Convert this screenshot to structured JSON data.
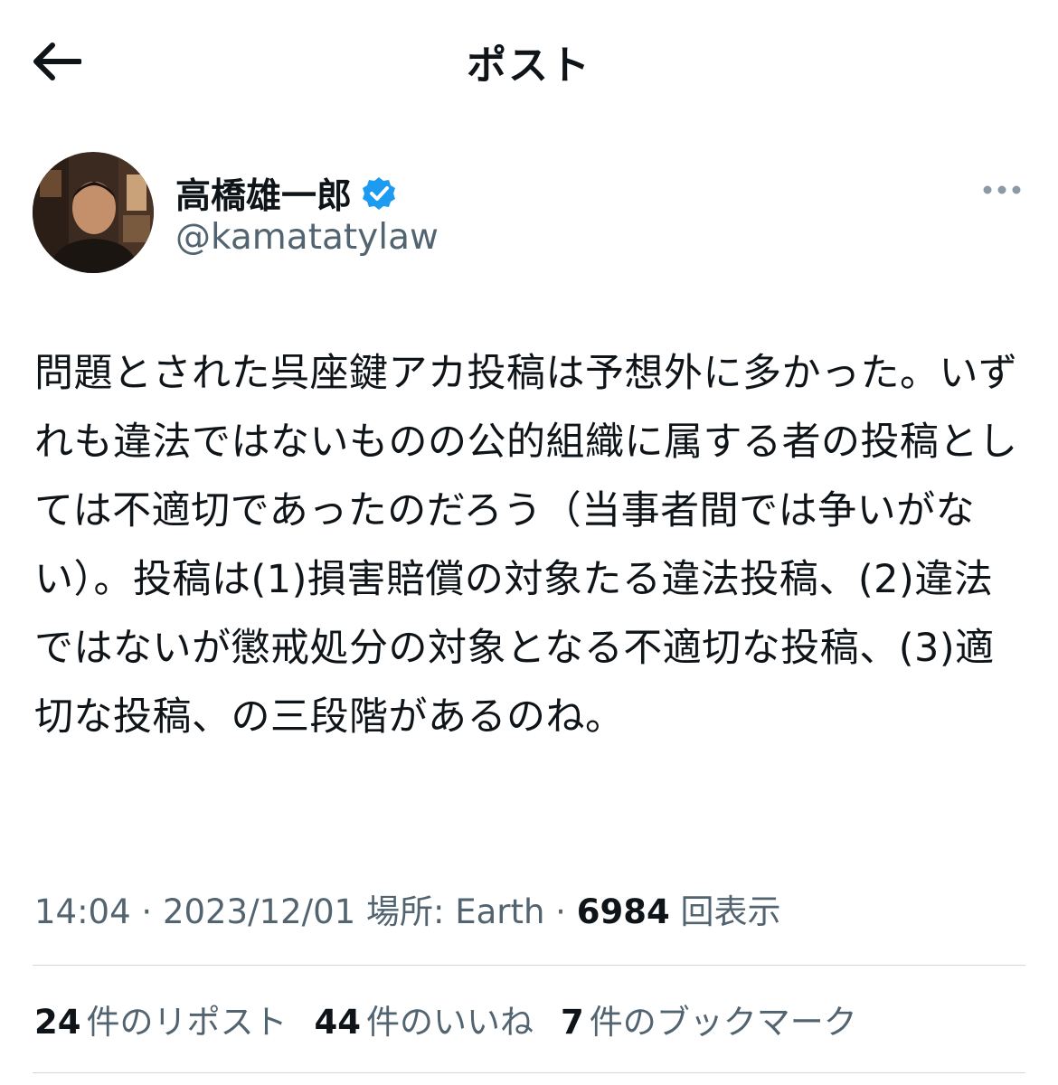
{
  "header": {
    "title": "ポスト",
    "back_icon": "arrow-left-icon"
  },
  "author": {
    "display_name": "高橋雄一郎",
    "handle": "@kamatatylaw",
    "verified_icon": "verified-badge-icon",
    "verified_color": "#1d9bf0",
    "more_icon": "more-horizontal-icon"
  },
  "post": {
    "text": "問題とされた呉座鍵アカ投稿は予想外に多かった。いずれも違法ではないものの公的組織に属する者の投稿としては不適切であったのだろう（当事者間では争いがない）。投稿は(1)損害賠償の対象たる違法投稿、(2)違法ではないが懲戒処分の対象となる不適切な投稿、(3)適切な投稿、の三段階があるのね。"
  },
  "meta": {
    "time": "14:04",
    "sep1": " · ",
    "date": "2023/12/01",
    "location": " 場所: Earth",
    "sep2": " · ",
    "views_count": "6984",
    "views_label": " 回表示"
  },
  "stats": [
    {
      "count": "24",
      "label": "件のリポスト"
    },
    {
      "count": "44",
      "label": "件のいいね"
    },
    {
      "count": "7",
      "label": "件のブックマーク"
    }
  ]
}
